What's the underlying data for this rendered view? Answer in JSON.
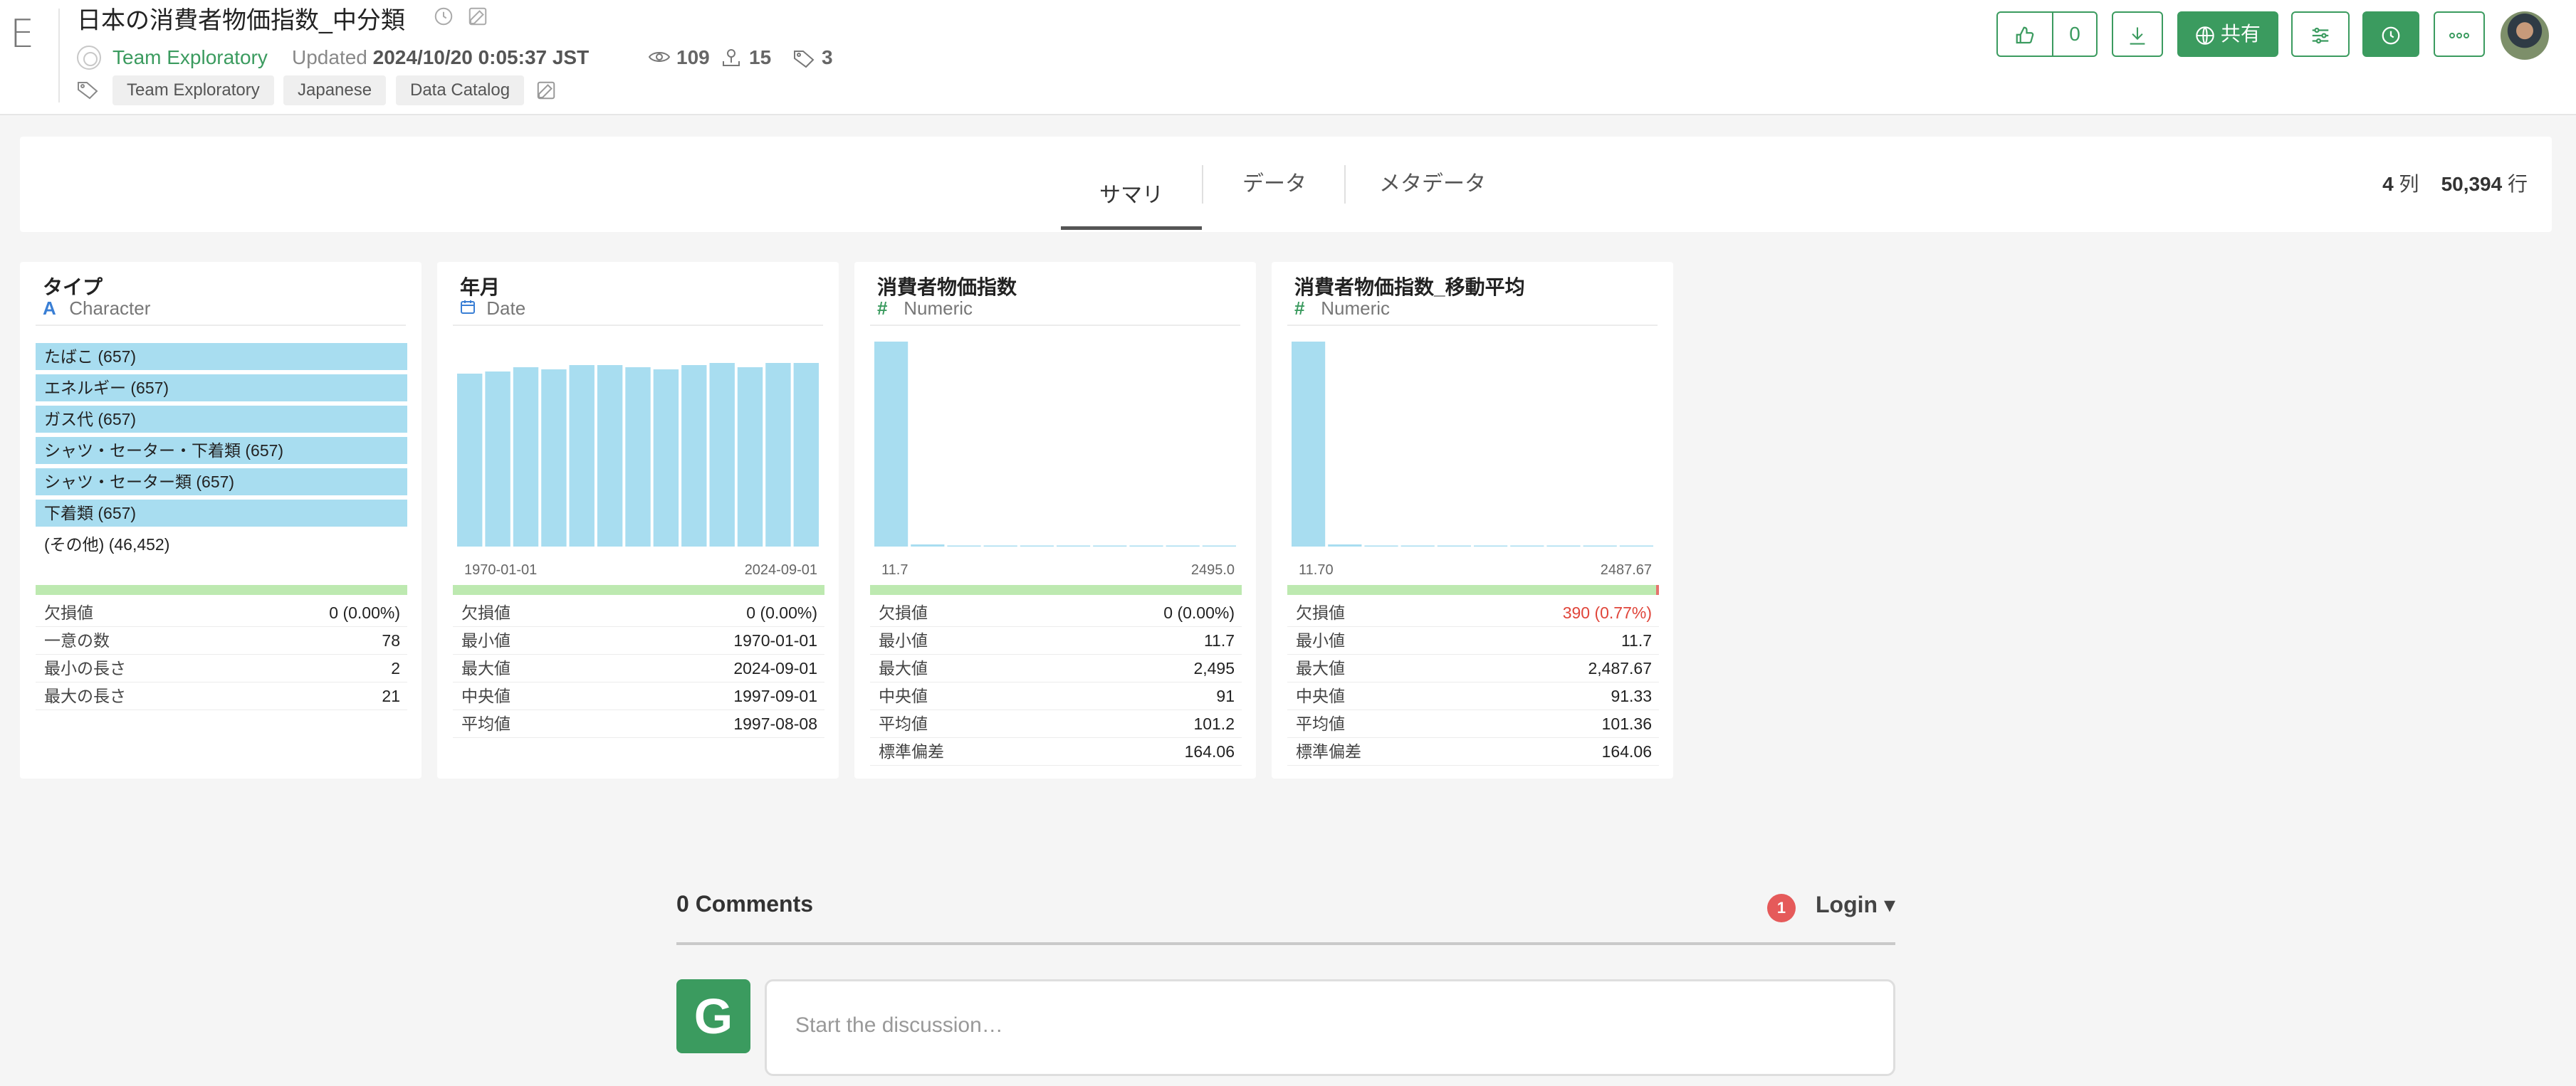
{
  "header": {
    "logo_glyph": "E",
    "title": "日本の消費者物価指数_中分類",
    "team": "Team Exploratory",
    "updated_prefix": "Updated",
    "updated_at": "2024/10/20 0:05:37 JST",
    "views": "109",
    "downloads": "15",
    "tags_count": "3",
    "tags": [
      "Team Exploratory",
      "Japanese",
      "Data Catalog"
    ],
    "like_count": "0",
    "share_label": "共有"
  },
  "tabs": [
    "サマリ",
    "データ",
    "メタデータ"
  ],
  "active_tab": "サマリ",
  "dims": {
    "cols": "4",
    "cols_unit": "列",
    "rows": "50,394",
    "rows_unit": "行"
  },
  "cards": [
    {
      "title": "タイプ",
      "type": "Character",
      "type_icon": "A",
      "categories": [
        "たばこ (657)",
        "エネルギー (657)",
        "ガス代 (657)",
        "シャツ・セーター・下着類 (657)",
        "シャツ・セーター類 (657)",
        "下着類 (657)"
      ],
      "other": "(その他) (46,452)",
      "stats": [
        [
          "欠損値",
          "0 (0.00%)"
        ],
        [
          "一意の数",
          "78"
        ],
        [
          "最小の長さ",
          "2"
        ],
        [
          "最大の長さ",
          "21"
        ]
      ]
    },
    {
      "title": "年月",
      "type": "Date",
      "axis_min": "1970-01-01",
      "axis_max": "2024-09-01",
      "stats": [
        [
          "欠損値",
          "0 (0.00%)"
        ],
        [
          "最小値",
          "1970-01-01"
        ],
        [
          "最大値",
          "2024-09-01"
        ],
        [
          "中央値",
          "1997-09-01"
        ],
        [
          "平均値",
          "1997-08-08"
        ]
      ]
    },
    {
      "title": "消費者物価指数",
      "type": "Numeric",
      "axis_min": "11.7",
      "axis_max": "2495.0",
      "stats": [
        [
          "欠損値",
          "0 (0.00%)"
        ],
        [
          "最小値",
          "11.7"
        ],
        [
          "最大値",
          "2,495"
        ],
        [
          "中央値",
          "91"
        ],
        [
          "平均値",
          "101.2"
        ],
        [
          "標準偏差",
          "164.06"
        ]
      ]
    },
    {
      "title": "消費者物価指数_移動平均",
      "type": "Numeric",
      "axis_min": "11.70",
      "axis_max": "2487.67",
      "missing_fraction": 0.0077,
      "stats": [
        [
          "欠損値",
          "390 (0.77%)"
        ],
        [
          "最小値",
          "11.7"
        ],
        [
          "最大値",
          "2,487.67"
        ],
        [
          "中央値",
          "91.33"
        ],
        [
          "平均値",
          "101.36"
        ],
        [
          "標準偏差",
          "164.06"
        ]
      ]
    }
  ],
  "histograms": {
    "date": [
      0.81,
      0.82,
      0.84,
      0.83,
      0.85,
      0.85,
      0.84,
      0.83,
      0.85,
      0.86,
      0.84,
      0.86,
      0.86
    ],
    "cpi": [
      0.99,
      0.01,
      0.005,
      0.004,
      0.004,
      0.004,
      0.004,
      0.004,
      0.004,
      0.004
    ],
    "cpi_ma": [
      0.99,
      0.01,
      0.005,
      0.004,
      0.004,
      0.004,
      0.004,
      0.004,
      0.004,
      0.004
    ]
  },
  "colors": {
    "accent": "#3b9b5f",
    "bar": "#a8ddf0",
    "valid": "#bde9b0",
    "missing": "#e5736e"
  },
  "comments": {
    "count_label": "0 Comments",
    "login_label": "Login ▾",
    "notifications": "1",
    "avatar_letter": "G",
    "placeholder": "Start the discussion…"
  }
}
